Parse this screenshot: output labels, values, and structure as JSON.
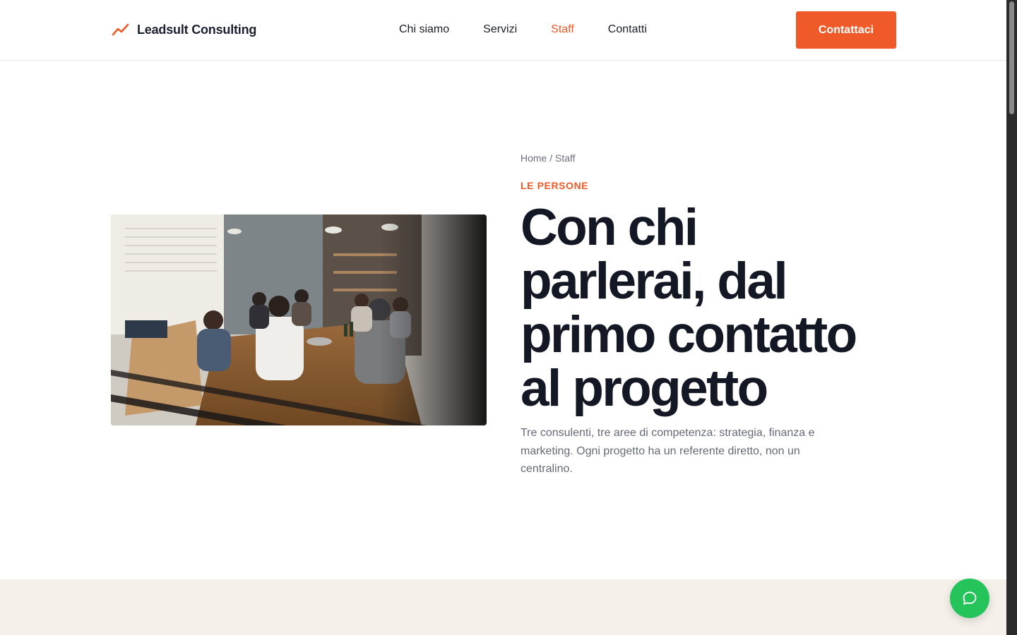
{
  "brand": {
    "name": "Leadsult Consulting",
    "accent": "#f05a28"
  },
  "nav": {
    "items": [
      {
        "label": "Chi siamo",
        "active": false
      },
      {
        "label": "Servizi",
        "active": false
      },
      {
        "label": "Staff",
        "active": true
      },
      {
        "label": "Contatti",
        "active": false
      }
    ],
    "cta_label": "Contattaci"
  },
  "hero": {
    "breadcrumb": {
      "home": "Home",
      "separator": "/",
      "current": "Staff"
    },
    "eyebrow": "LE PERSONE",
    "title_lines": [
      "Con chi",
      "parlerai, dal",
      "primo contatto",
      "al progetto"
    ],
    "lead": "Tre consulenti, tre aree di competenza: strategia, finanza e marketing. Ogni progetto ha un referente diretto, non un centralino."
  },
  "chat": {
    "icon": "chat-bubble-icon",
    "color": "#25c45a"
  },
  "colors": {
    "beige_section": "#f5f0ea",
    "text_dark": "#141824",
    "text_muted": "#646a78"
  }
}
